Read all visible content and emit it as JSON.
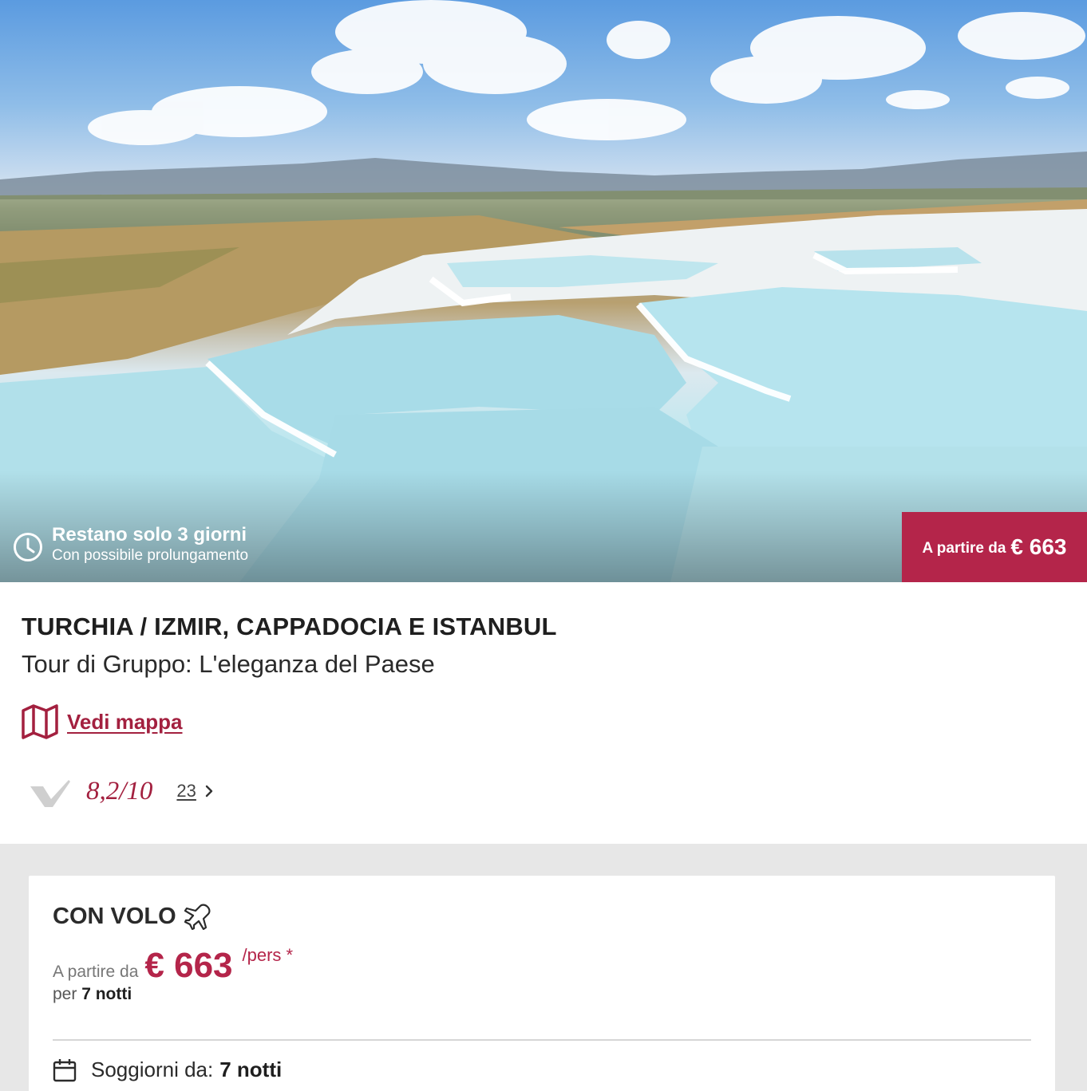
{
  "hero": {
    "countdown_main": "Restano solo 3 giorni",
    "countdown_sub": "Con possibile prolungamento",
    "badge_label": "A partire da",
    "badge_price": "€ 663"
  },
  "trip": {
    "title": "TURCHIA / IZMIR, CAPPADOCIA E ISTANBUL",
    "subtitle": "Tour di Gruppo: L'eleganza del Paese",
    "map_link": "Vedi mappa"
  },
  "rating": {
    "score": "8,2/10",
    "reviews_count": "23"
  },
  "offer": {
    "title": "CON VOLO",
    "from_label": "A partire da",
    "price": "€ 663",
    "per_person": "/pers *",
    "per_label": "per",
    "nights": "7 notti",
    "stay_label": "Soggiorni da:",
    "stay_value": "7 notti"
  },
  "colors": {
    "accent": "#b4254a",
    "link": "#a3203f",
    "page_gray": "#e7e7e7"
  },
  "icons": [
    "clock-icon",
    "map-icon",
    "rating-logo-icon",
    "chevron-right-icon",
    "plane-icon",
    "calendar-icon"
  ]
}
